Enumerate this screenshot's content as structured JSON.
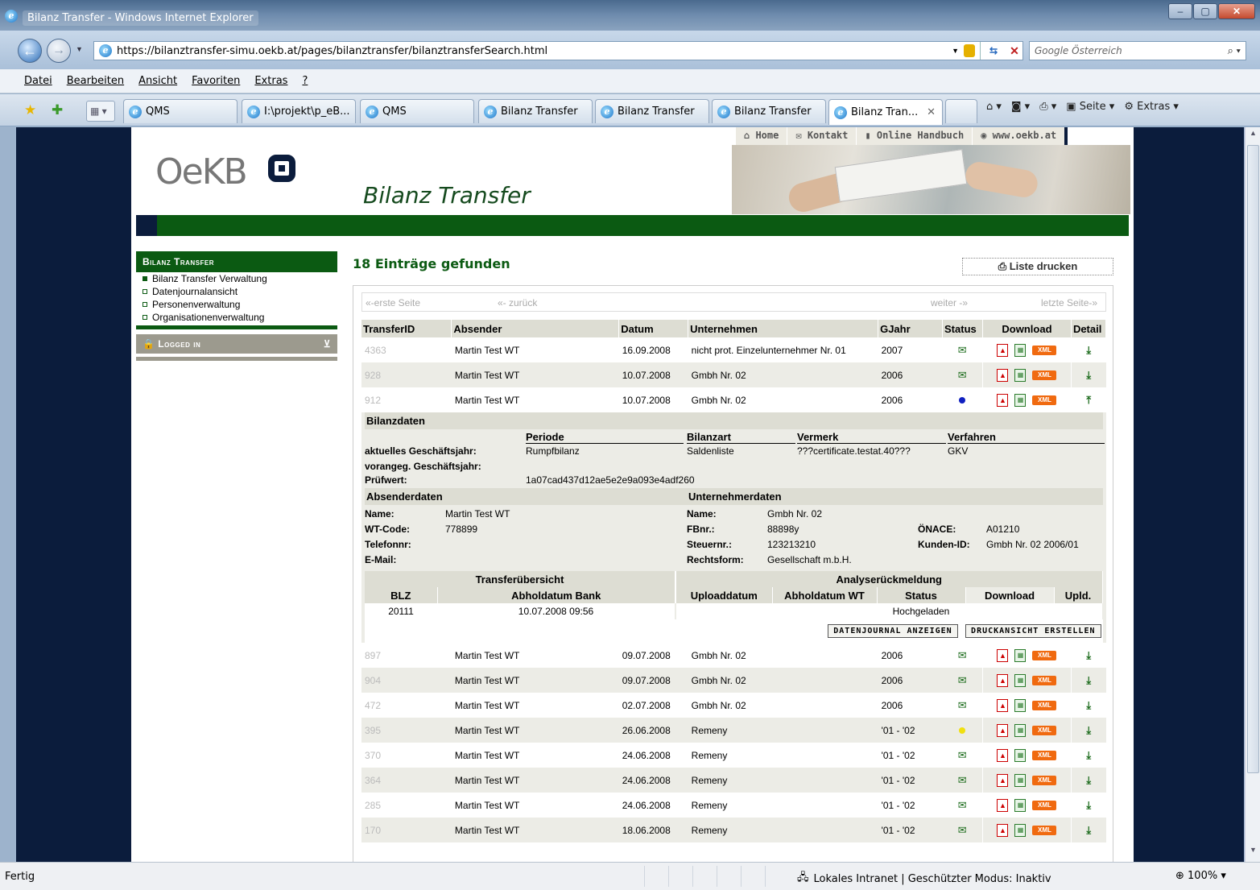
{
  "window": {
    "title": "Bilanz Transfer - Windows Internet Explorer",
    "min": "–",
    "max": "▢",
    "close": "✕"
  },
  "address": {
    "url": "https://bilanztransfer-simu.oekb.at/pages/bilanztransfer/bilanztransferSearch.html",
    "search_placeholder": "Google Österreich"
  },
  "menu": [
    "Datei",
    "Bearbeiten",
    "Ansicht",
    "Favoriten",
    "Extras",
    "?"
  ],
  "tabs": [
    "QMS",
    "I:\\projekt\\p_eB...",
    "QMS",
    "Bilanz Transfer",
    "Bilanz Transfer",
    "Bilanz Transfer",
    "Bilanz Tran..."
  ],
  "toolbar": {
    "page": "Seite",
    "extras": "Extras"
  },
  "status": {
    "left": "Fertig",
    "zone": "Lokales Intranet | Geschützter Modus: Inaktiv",
    "zoom": "100%"
  },
  "site": {
    "topnav": [
      "Home",
      "Kontakt",
      "Online Handbuch",
      "www.oekb.at"
    ],
    "logo": "OeKB",
    "title": "Bilanz Transfer",
    "sidebar": {
      "head": "Bilanz Transfer",
      "items": [
        "Bilanz Transfer Verwaltung",
        "Datenjournalansicht",
        "Personenverwaltung",
        "Organisationenverwaltung"
      ],
      "logged": "Logged in"
    },
    "found": "18 Einträge gefunden",
    "print": "Liste drucken",
    "pager": {
      "first": "«-erste Seite",
      "prev": "«- zurück",
      "next": "weiter -»",
      "last": "letzte Seite-»"
    },
    "headers": {
      "id": "TransferID",
      "sender": "Absender",
      "date": "Datum",
      "company": "Unternehmen",
      "year": "GJahr",
      "status": "Status",
      "download": "Download",
      "detail": "Detail"
    },
    "rows_top": [
      {
        "id": "4363",
        "sender": "Martin Test WT",
        "date": "16.09.2008",
        "company": "nicht prot. Einzelunternehmer Nr. 01",
        "year": "2007",
        "status": "env"
      },
      {
        "id": "928",
        "sender": "Martin Test WT",
        "date": "10.07.2008",
        "company": "Gmbh Nr. 02",
        "year": "2006",
        "status": "env"
      },
      {
        "id": "912",
        "sender": "Martin Test WT",
        "date": "10.07.2008",
        "company": "Gmbh Nr. 02",
        "year": "2006",
        "status": "blue"
      }
    ],
    "detail": {
      "bilanz_head": "Bilanzdaten",
      "cols": {
        "periode": "Periode",
        "bilanzart": "Bilanzart",
        "vermerk": "Vermerk",
        "verfahren": "Verfahren"
      },
      "current_label": "aktuelles Geschäftsjahr:",
      "current": {
        "periode": "Rumpfbilanz",
        "bilanzart": "Saldenliste",
        "vermerk": "???certificate.testat.40???",
        "verfahren": "GKV"
      },
      "prev_label": "vorangeg. Geschäftsjahr:",
      "check_label": "Prüfwert:",
      "check": "1a07cad437d12ae5e2e9a093e4adf260",
      "sender_head": "Absenderdaten",
      "company_head": "Unternehmerdaten",
      "s_name_l": "Name:",
      "s_name": "Martin Test WT",
      "s_wt_l": "WT-Code:",
      "s_wt": "778899",
      "s_tel_l": "Telefonnr:",
      "s_mail_l": "E-Mail:",
      "c_name_l": "Name:",
      "c_name": "Gmbh Nr. 02",
      "c_fb_l": "FBnr.:",
      "c_fb": "88898y",
      "c_st_l": "Steuernr.:",
      "c_st": "123213210",
      "c_rf_l": "Rechtsform:",
      "c_rf": "Gesellschaft m.b.H.",
      "c_on_l": "ÖNACE:",
      "c_on": "A01210",
      "c_kid_l": "Kunden-ID:",
      "c_kid": "Gmbh Nr. 02 2006/01",
      "transfer_head": "Transferübersicht",
      "analyse_head": "Analyserückmeldung",
      "sub": {
        "blz": "BLZ",
        "abhol_bank": "Abholdatum Bank",
        "upload": "Uploaddatum",
        "abhol_wt": "Abholdatum WT",
        "status": "Status",
        "download": "Download",
        "upld": "Upld."
      },
      "subrow": {
        "blz": "20111",
        "abhol_bank": "10.07.2008 09:56",
        "status": "Hochgeladen"
      },
      "btn1": "DATENJOURNAL ANZEIGEN",
      "btn2": "DRUCKANSICHT ERSTELLEN"
    },
    "rows_bottom": [
      {
        "id": "897",
        "sender": "Martin Test WT",
        "date": "09.07.2008",
        "company": "Gmbh Nr. 02",
        "year": "2006",
        "status": "env"
      },
      {
        "id": "904",
        "sender": "Martin Test WT",
        "date": "09.07.2008",
        "company": "Gmbh Nr. 02",
        "year": "2006",
        "status": "env"
      },
      {
        "id": "472",
        "sender": "Martin Test WT",
        "date": "02.07.2008",
        "company": "Gmbh Nr. 02",
        "year": "2006",
        "status": "env"
      },
      {
        "id": "395",
        "sender": "Martin Test WT",
        "date": "26.06.2008",
        "company": "Remeny",
        "year": "'01 - '02",
        "status": "yellow"
      },
      {
        "id": "370",
        "sender": "Martin Test WT",
        "date": "24.06.2008",
        "company": "Remeny",
        "year": "'01 - '02",
        "status": "env"
      },
      {
        "id": "364",
        "sender": "Martin Test WT",
        "date": "24.06.2008",
        "company": "Remeny",
        "year": "'01 - '02",
        "status": "env"
      },
      {
        "id": "285",
        "sender": "Martin Test WT",
        "date": "24.06.2008",
        "company": "Remeny",
        "year": "'01 - '02",
        "status": "env"
      },
      {
        "id": "170",
        "sender": "Martin Test WT",
        "date": "18.06.2008",
        "company": "Remeny",
        "year": "'01 - '02",
        "status": "env"
      }
    ],
    "xml": "XML"
  }
}
